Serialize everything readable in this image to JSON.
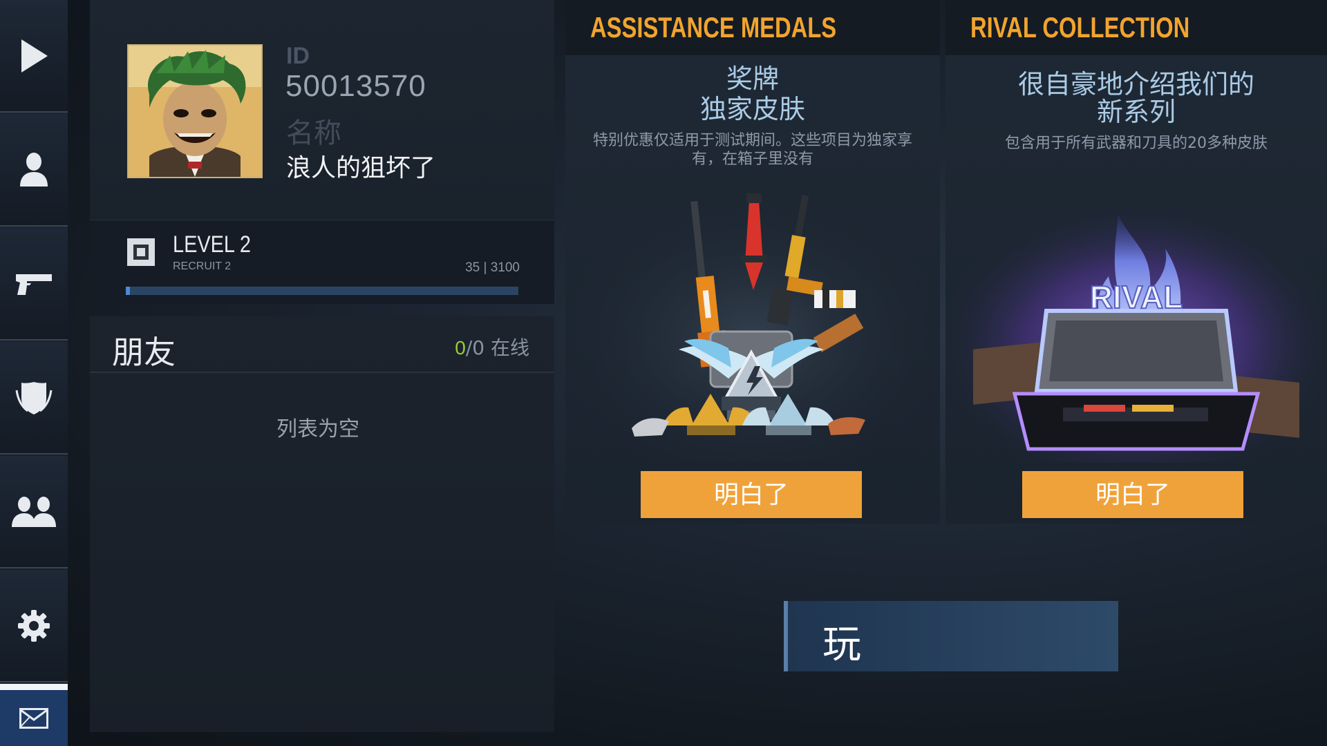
{
  "nav": {
    "items": [
      {
        "icon": "play-icon"
      },
      {
        "icon": "profile-icon"
      },
      {
        "icon": "pistol-icon"
      },
      {
        "icon": "clan-shield-icon"
      },
      {
        "icon": "friends-icon"
      },
      {
        "icon": "settings-gear-icon"
      },
      {
        "icon": "mail-icon"
      }
    ]
  },
  "profile": {
    "id_label": "ID",
    "id_value": "50013570",
    "name_label": "名称",
    "name_value": "浪人的狙坏了"
  },
  "level": {
    "title": "LEVEL 2",
    "rank": "RECRUIT 2",
    "xp_text": "35 | 3100",
    "xp_current": 35,
    "xp_max": 3100,
    "progress_color": "#4a8ad8"
  },
  "friends": {
    "title": "朋友",
    "online_count": "0",
    "total_text": "/0 在线",
    "empty_text": "列表为空"
  },
  "cards": [
    {
      "title": "ASSISTANCE MEDALS",
      "headline_1": "奖牌",
      "headline_2": "独家皮肤",
      "description": "特别优惠仅适用于测试期间。这些项目为独家享有，在箱子里没有",
      "button_label": "明白了"
    },
    {
      "title": "RIVAL COLLECTION",
      "headline_1": "很自豪地介绍我们的",
      "headline_2": "新系列",
      "description": "包含用于所有武器和刀具的20多种皮肤",
      "case_logo": "RIVAL",
      "button_label": "明白了"
    }
  ],
  "play_button": {
    "label": "玩"
  },
  "colors": {
    "accent_orange": "#f0a23a",
    "title_orange": "#f2a42e",
    "online_green": "#9acd32",
    "nav_active_blue": "#1e3a66"
  }
}
